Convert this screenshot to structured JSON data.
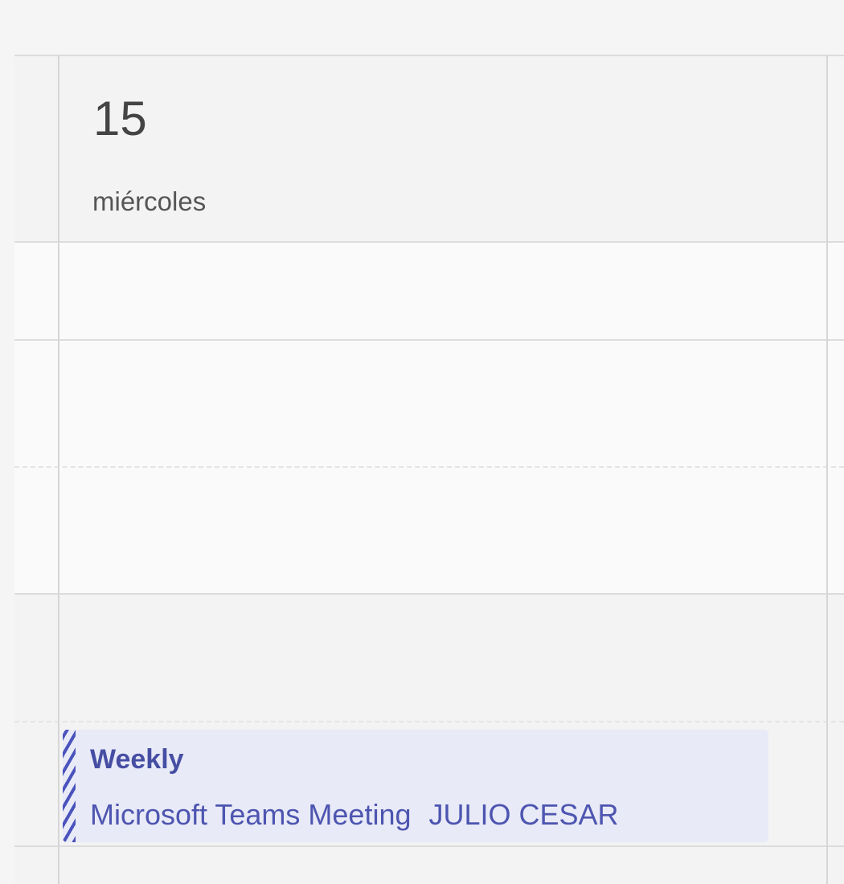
{
  "calendar": {
    "day_column": {
      "date_number": "15",
      "weekday": "miércoles"
    },
    "event": {
      "title": "Weekly",
      "location": "Microsoft Teams Meeting",
      "organizer": "JULIO CESAR",
      "status_pattern": "tentative-striped",
      "accent_color": "#4b53bc",
      "background_color": "#e8eaf7"
    }
  }
}
